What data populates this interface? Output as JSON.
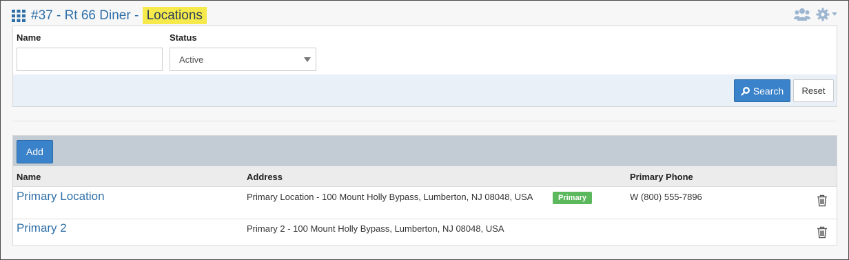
{
  "header": {
    "title_prefix": "#37 - Rt 66 Diner - ",
    "title_highlight": "Locations",
    "icons": [
      "grid-icon",
      "users-icon",
      "gear-icon",
      "caret-down-icon"
    ]
  },
  "filters": {
    "name_label": "Name",
    "name_value": "",
    "status_label": "Status",
    "status_value": "Active",
    "search_label": "Search",
    "reset_label": "Reset"
  },
  "table": {
    "add_label": "Add",
    "columns": [
      "Name",
      "Address",
      "Primary Phone"
    ],
    "rows": [
      {
        "name": "Primary Location",
        "address": "Primary Location - 100 Mount Holly Bypass, Lumberton, NJ 08048, USA",
        "badge": "Primary",
        "phone": "W (800) 555-7896"
      },
      {
        "name": "Primary 2",
        "address": "Primary 2 - 100 Mount Holly Bypass, Lumberton, NJ 08048, USA",
        "badge": "",
        "phone": ""
      }
    ]
  },
  "colors": {
    "accent": "#3a82c9",
    "title": "#2f6fa8",
    "highlight": "#f5e94b",
    "badge": "#5cb85c"
  }
}
